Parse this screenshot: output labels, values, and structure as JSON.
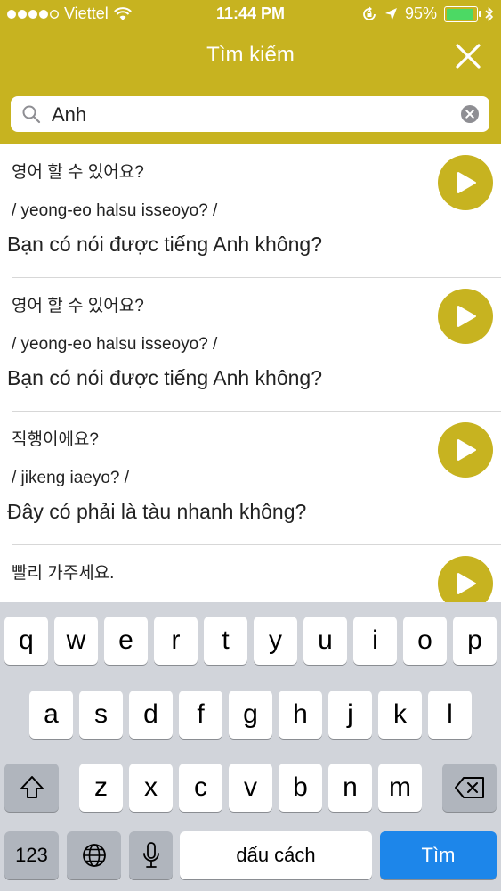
{
  "status_bar": {
    "carrier": "Viettel",
    "time": "11:44 PM",
    "battery": "95%"
  },
  "nav": {
    "title": "Tìm kiếm"
  },
  "search": {
    "value": "Anh",
    "placeholder": ""
  },
  "results": [
    {
      "korean": "영어 할 수 있어요?",
      "roman": "/ yeong-eo halsu isseoyo? /",
      "vietnamese": "Bạn có nói được tiếng Anh không?"
    },
    {
      "korean": "영어 할 수 있어요?",
      "roman": "/ yeong-eo halsu isseoyo? /",
      "vietnamese": "Bạn có nói được tiếng Anh không?"
    },
    {
      "korean": "직행이에요?",
      "roman": "/ jikeng iaeyo? /",
      "vietnamese": "Đây có phải là tàu nhanh không?"
    },
    {
      "korean": "빨리 가주세요.",
      "roman": "",
      "vietnamese": ""
    }
  ],
  "keyboard": {
    "row1": [
      "q",
      "w",
      "e",
      "r",
      "t",
      "y",
      "u",
      "i",
      "o",
      "p"
    ],
    "row2": [
      "a",
      "s",
      "d",
      "f",
      "g",
      "h",
      "j",
      "k",
      "l"
    ],
    "row3": [
      "z",
      "x",
      "c",
      "v",
      "b",
      "n",
      "m"
    ],
    "numbers_label": "123",
    "space_label": "dấu cách",
    "go_label": "Tìm"
  },
  "colors": {
    "accent": "#c7b320",
    "go_key": "#1d86ea",
    "battery_fill": "#4cd964"
  },
  "icons": [
    "signal-dots-icon",
    "wifi-icon",
    "orientation-lock-icon",
    "location-arrow-icon",
    "battery-icon",
    "bluetooth-icon",
    "close-icon",
    "search-icon",
    "clear-icon",
    "play-icon",
    "shift-icon",
    "backspace-icon",
    "globe-icon",
    "microphone-icon"
  ]
}
